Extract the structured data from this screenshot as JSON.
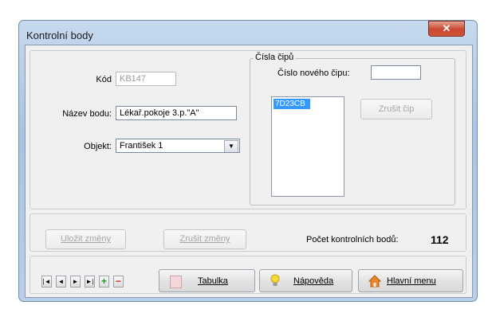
{
  "window": {
    "title": "Kontrolní body",
    "close_glyph": "✕"
  },
  "form": {
    "kod_label": "Kód",
    "kod_value": "KB147",
    "nazev_label": "Název bodu:",
    "nazev_value": "Lékař.pokoje 3.p.\"A\"",
    "objekt_label": "Objekt:",
    "objekt_value": "František 1"
  },
  "chips": {
    "group_label": "Čísla čipů",
    "new_chip_label": "Číslo nového čipu:",
    "new_chip_value": "",
    "list": [
      "7D23CB"
    ],
    "delete_chip_label": "Zrušit čip"
  },
  "actions": {
    "save_label": "Uložit změny",
    "cancel_label": "Zrušit změny",
    "count_label": "Počet kontrolních bodů:",
    "count_value": "112"
  },
  "toolbar": {
    "nav_first": "|◄",
    "nav_prev": "◄",
    "nav_next": "►",
    "nav_last": "►|",
    "add_glyph": "+",
    "remove_glyph": "−",
    "table_label": "Tabulka",
    "help_label": "Nápověda",
    "main_menu_label": "Hlavní menu"
  },
  "colors": {
    "accent_selected": "#3399ff",
    "add_green": "#1c9a2a",
    "remove_red": "#d42020"
  }
}
